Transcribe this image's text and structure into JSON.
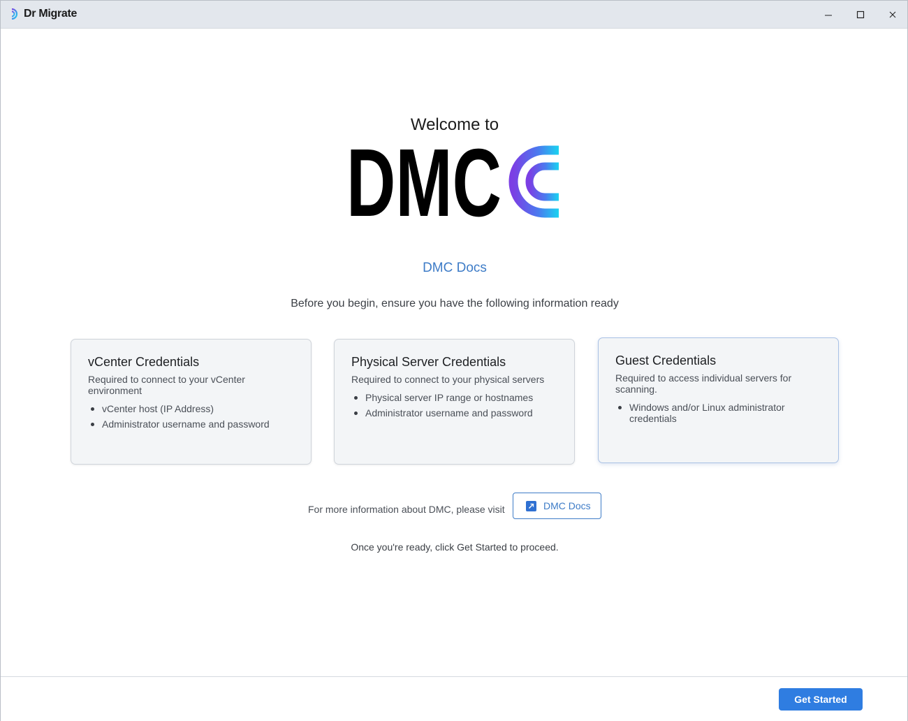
{
  "window": {
    "title": "Dr Migrate"
  },
  "main": {
    "welcome": "Welcome to",
    "logo_text": "DMC",
    "docs_link": "DMC Docs",
    "intro": "Before you begin, ensure you have the following information ready"
  },
  "cards": [
    {
      "title": "vCenter Credentials",
      "description": "Required to connect to your vCenter environment",
      "items": [
        "vCenter host (IP Address)",
        "Administrator username and password"
      ]
    },
    {
      "title": "Physical Server Credentials",
      "description": "Required to connect to your physical servers",
      "items": [
        "Physical server IP range or hostnames",
        "Administrator username and password"
      ]
    },
    {
      "title": "Guest Credentials",
      "description": "Required to access individual servers for scanning.",
      "items": [
        "Windows and/or Linux administrator credentials"
      ]
    }
  ],
  "more_info": {
    "text": "For more information about DMC, please visit",
    "button_label": "DMC Docs",
    "button_icon": "external-link-icon"
  },
  "ready_text": "Once you're ready, click Get Started to proceed.",
  "footer": {
    "start_label": "Get Started"
  },
  "colors": {
    "accent": "#2f7de1",
    "link": "#3e7cc7",
    "logo_gradient_start": "#7b3fe4",
    "logo_gradient_end": "#19d3f0"
  }
}
